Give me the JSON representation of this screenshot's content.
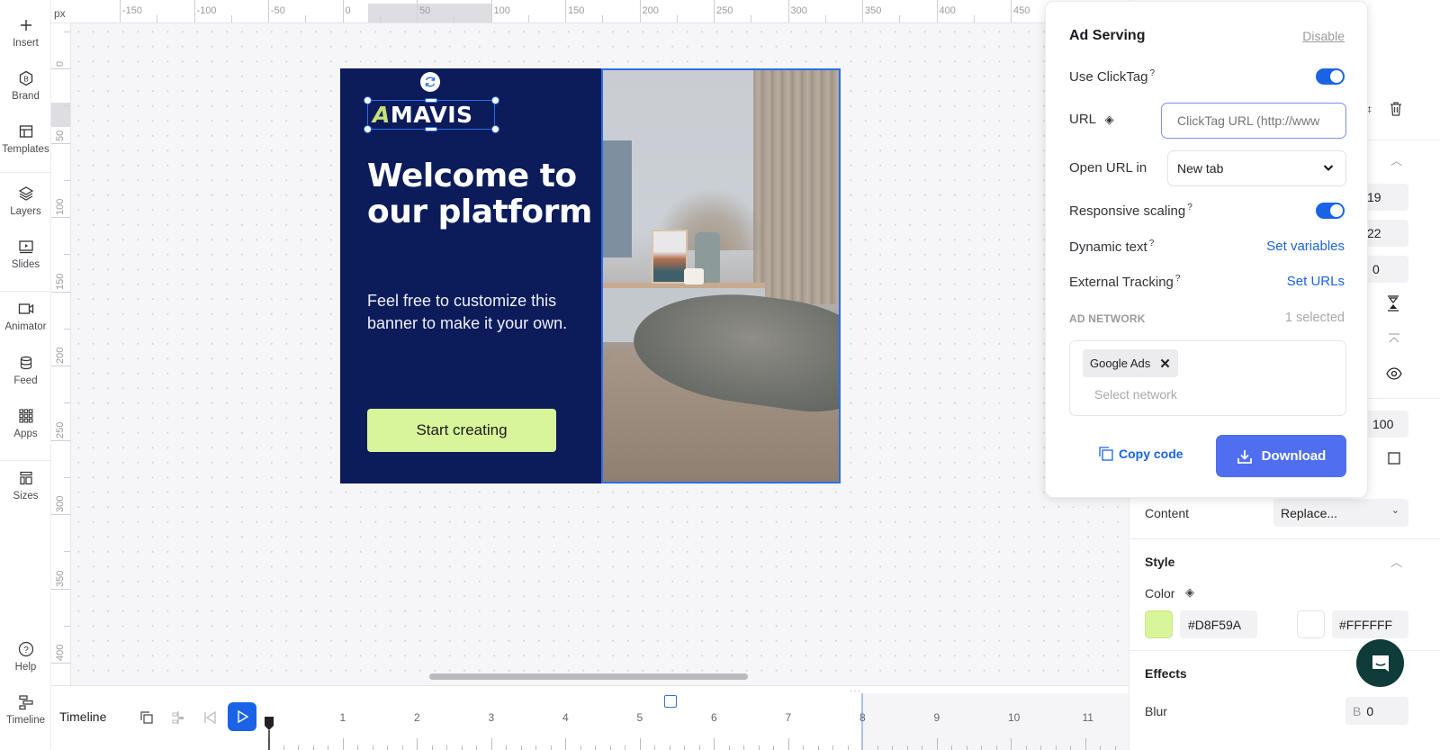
{
  "sidebar": {
    "items": [
      {
        "label": "Insert",
        "icon": "plus-icon"
      },
      {
        "label": "Brand",
        "icon": "brand-hexagon-icon"
      },
      {
        "label": "Templates",
        "icon": "templates-icon"
      },
      {
        "label": "Layers",
        "icon": "layers-icon"
      },
      {
        "label": "Slides",
        "icon": "slides-icon"
      },
      {
        "label": "Animator",
        "icon": "video-camera-icon"
      },
      {
        "label": "Feed",
        "icon": "database-icon"
      },
      {
        "label": "Apps",
        "icon": "apps-grid-icon"
      },
      {
        "label": "Sizes",
        "icon": "sizes-icon"
      },
      {
        "label": "Help",
        "icon": "help-icon"
      },
      {
        "label": "Timeline",
        "icon": "timeline-icon"
      }
    ]
  },
  "ruler": {
    "unit": "px",
    "top_labels": [
      "-150",
      "-100",
      "-50",
      "0",
      "50",
      "100",
      "150",
      "200",
      "250",
      "300",
      "350",
      "400",
      "450"
    ],
    "left_labels": [
      "0",
      "50",
      "100",
      "150",
      "200",
      "250",
      "300",
      "350",
      "400"
    ]
  },
  "banner": {
    "logo": "MAVIS",
    "logo_mark": "A",
    "headline": "Welcome to our platform",
    "subtext": "Feel free to customize this banner to make it your own.",
    "cta": "Start creating",
    "background_color": "#0c1c5b",
    "cta_color": "#D8F59A"
  },
  "timeline": {
    "title": "Timeline",
    "ticks": [
      "1",
      "2",
      "3",
      "4",
      "5",
      "6",
      "7",
      "8",
      "9",
      "10",
      "11"
    ],
    "end_marker": "8"
  },
  "ad_serving": {
    "title": "Ad Serving",
    "disable_label": "Disable",
    "use_clicktag_label": "Use ClickTag",
    "use_clicktag_on": true,
    "url_label": "URL",
    "url_placeholder": "ClickTag URL (http://www",
    "url_value": "",
    "open_url_label": "Open URL in",
    "open_url_value": "New tab",
    "responsive_label": "Responsive scaling",
    "responsive_on": true,
    "dynamic_text_label": "Dynamic text",
    "dynamic_text_link": "Set variables",
    "external_tracking_label": "External Tracking",
    "external_tracking_link": "Set URLs",
    "help_mark": "?",
    "ad_network_label": "AD NETWORK",
    "ad_network_count": "1 selected",
    "selected_networks": [
      "Google Ads"
    ],
    "network_placeholder": "Select network",
    "copy_code_label": "Copy code",
    "download_label": "Download"
  },
  "properties": {
    "fields": [
      "19",
      "22",
      "0"
    ],
    "opacity": "100",
    "content_label": "Content",
    "content_value": "Replace...",
    "style_title": "Style",
    "color_label": "Color",
    "color_1": "#D8F59A",
    "color_2": "#FFFFFF",
    "effects_title": "Effects",
    "blur_label": "Blur",
    "blur_prefix": "B",
    "blur_value": "0"
  }
}
